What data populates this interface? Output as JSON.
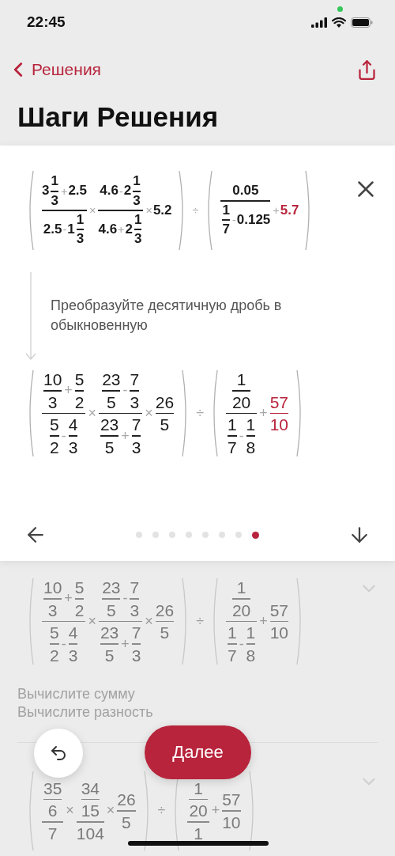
{
  "status_bar": {
    "time": "22:45"
  },
  "nav": {
    "back": "Решения"
  },
  "title": "Шаги Решения",
  "card": {
    "expression": [
      {
        "kind": "paren",
        "body": [
          {
            "kind": "frac",
            "top": [
              {
                "kind": "num",
                "v": "3"
              },
              {
                "kind": "frac",
                "top": [
                  {
                    "kind": "num",
                    "v": "1"
                  }
                ],
                "bottom": [
                  {
                    "kind": "num",
                    "v": "3"
                  }
                ]
              },
              {
                "kind": "op",
                "v": "+"
              },
              {
                "kind": "num",
                "v": "2.5"
              }
            ],
            "bottom": [
              {
                "kind": "num",
                "v": "2.5"
              },
              {
                "kind": "op",
                "v": "-"
              },
              {
                "kind": "num",
                "v": "1"
              },
              {
                "kind": "frac",
                "top": [
                  {
                    "kind": "num",
                    "v": "1"
                  }
                ],
                "bottom": [
                  {
                    "kind": "num",
                    "v": "3"
                  }
                ]
              }
            ]
          },
          {
            "kind": "op",
            "v": "×"
          },
          {
            "kind": "frac",
            "top": [
              {
                "kind": "num",
                "v": "4.6"
              },
              {
                "kind": "op",
                "v": "-"
              },
              {
                "kind": "num",
                "v": "2"
              },
              {
                "kind": "frac",
                "top": [
                  {
                    "kind": "num",
                    "v": "1"
                  }
                ],
                "bottom": [
                  {
                    "kind": "num",
                    "v": "3"
                  }
                ]
              }
            ],
            "bottom": [
              {
                "kind": "num",
                "v": "4.6"
              },
              {
                "kind": "op",
                "v": "+"
              },
              {
                "kind": "num",
                "v": "2"
              },
              {
                "kind": "frac",
                "top": [
                  {
                    "kind": "num",
                    "v": "1"
                  }
                ],
                "bottom": [
                  {
                    "kind": "num",
                    "v": "3"
                  }
                ]
              }
            ]
          },
          {
            "kind": "op",
            "v": "×"
          },
          {
            "kind": "num",
            "v": "5.2"
          }
        ]
      },
      {
        "kind": "op",
        "v": "÷"
      },
      {
        "kind": "paren",
        "body": [
          {
            "kind": "frac",
            "top": [
              {
                "kind": "num",
                "v": "0.05"
              }
            ],
            "bottom": [
              {
                "kind": "frac",
                "top": [
                  {
                    "kind": "num",
                    "v": "1"
                  }
                ],
                "bottom": [
                  {
                    "kind": "num",
                    "v": "7"
                  }
                ]
              },
              {
                "kind": "op",
                "v": "-"
              },
              {
                "kind": "num",
                "v": "0.125"
              }
            ]
          },
          {
            "kind": "op",
            "v": "+"
          },
          {
            "kind": "accent",
            "body": [
              {
                "kind": "num",
                "v": "5.7"
              }
            ]
          }
        ]
      }
    ],
    "instruction": "Преобразуйте десятичную дробь в обыкновенную",
    "result": [
      {
        "kind": "paren",
        "body": [
          {
            "kind": "frac",
            "top": [
              {
                "kind": "frac",
                "top": [
                  {
                    "kind": "num",
                    "v": "10"
                  }
                ],
                "bottom": [
                  {
                    "kind": "num",
                    "v": "3"
                  }
                ]
              },
              {
                "kind": "op",
                "v": "+"
              },
              {
                "kind": "frac",
                "top": [
                  {
                    "kind": "num",
                    "v": "5"
                  }
                ],
                "bottom": [
                  {
                    "kind": "num",
                    "v": "2"
                  }
                ]
              }
            ],
            "bottom": [
              {
                "kind": "frac",
                "top": [
                  {
                    "kind": "num",
                    "v": "5"
                  }
                ],
                "bottom": [
                  {
                    "kind": "num",
                    "v": "2"
                  }
                ]
              },
              {
                "kind": "op",
                "v": "-"
              },
              {
                "kind": "frac",
                "top": [
                  {
                    "kind": "num",
                    "v": "4"
                  }
                ],
                "bottom": [
                  {
                    "kind": "num",
                    "v": "3"
                  }
                ]
              }
            ]
          },
          {
            "kind": "op",
            "v": "×"
          },
          {
            "kind": "frac",
            "top": [
              {
                "kind": "frac",
                "top": [
                  {
                    "kind": "num",
                    "v": "23"
                  }
                ],
                "bottom": [
                  {
                    "kind": "num",
                    "v": "5"
                  }
                ]
              },
              {
                "kind": "op",
                "v": "-"
              },
              {
                "kind": "frac",
                "top": [
                  {
                    "kind": "num",
                    "v": "7"
                  }
                ],
                "bottom": [
                  {
                    "kind": "num",
                    "v": "3"
                  }
                ]
              }
            ],
            "bottom": [
              {
                "kind": "frac",
                "top": [
                  {
                    "kind": "num",
                    "v": "23"
                  }
                ],
                "bottom": [
                  {
                    "kind": "num",
                    "v": "5"
                  }
                ]
              },
              {
                "kind": "op",
                "v": "+"
              },
              {
                "kind": "frac",
                "top": [
                  {
                    "kind": "num",
                    "v": "7"
                  }
                ],
                "bottom": [
                  {
                    "kind": "num",
                    "v": "3"
                  }
                ]
              }
            ]
          },
          {
            "kind": "op",
            "v": "×"
          },
          {
            "kind": "frac",
            "top": [
              {
                "kind": "num",
                "v": "26"
              }
            ],
            "bottom": [
              {
                "kind": "num",
                "v": "5"
              }
            ]
          }
        ]
      },
      {
        "kind": "op",
        "v": "÷"
      },
      {
        "kind": "paren",
        "body": [
          {
            "kind": "frac",
            "top": [
              {
                "kind": "frac",
                "top": [
                  {
                    "kind": "num",
                    "v": "1"
                  }
                ],
                "bottom": [
                  {
                    "kind": "num",
                    "v": "20"
                  }
                ]
              }
            ],
            "bottom": [
              {
                "kind": "frac",
                "top": [
                  {
                    "kind": "num",
                    "v": "1"
                  }
                ],
                "bottom": [
                  {
                    "kind": "num",
                    "v": "7"
                  }
                ]
              },
              {
                "kind": "op",
                "v": "-"
              },
              {
                "kind": "frac",
                "top": [
                  {
                    "kind": "num",
                    "v": "1"
                  }
                ],
                "bottom": [
                  {
                    "kind": "num",
                    "v": "8"
                  }
                ]
              }
            ]
          },
          {
            "kind": "op",
            "v": "+"
          },
          {
            "kind": "accent",
            "body": [
              {
                "kind": "frac",
                "top": [
                  {
                    "kind": "num",
                    "v": "57"
                  }
                ],
                "bottom": [
                  {
                    "kind": "num",
                    "v": "10"
                  }
                ]
              }
            ]
          }
        ]
      }
    ],
    "pager": [
      {
        "selected": false
      },
      {
        "selected": false
      },
      {
        "selected": false
      },
      {
        "selected": false
      },
      {
        "selected": false
      },
      {
        "selected": false
      },
      {
        "selected": false
      },
      {
        "selected": true
      }
    ]
  },
  "steps": [
    {
      "expression": [
        {
          "kind": "paren",
          "body": [
            {
              "kind": "frac",
              "top": [
                {
                  "kind": "frac",
                  "top": [
                    {
                      "kind": "num",
                      "v": "10"
                    }
                  ],
                  "bottom": [
                    {
                      "kind": "num",
                      "v": "3"
                    }
                  ]
                },
                {
                  "kind": "op",
                  "v": "+"
                },
                {
                  "kind": "frac",
                  "top": [
                    {
                      "kind": "num",
                      "v": "5"
                    }
                  ],
                  "bottom": [
                    {
                      "kind": "num",
                      "v": "2"
                    }
                  ]
                }
              ],
              "bottom": [
                {
                  "kind": "frac",
                  "top": [
                    {
                      "kind": "num",
                      "v": "5"
                    }
                  ],
                  "bottom": [
                    {
                      "kind": "num",
                      "v": "2"
                    }
                  ]
                },
                {
                  "kind": "op",
                  "v": "-"
                },
                {
                  "kind": "frac",
                  "top": [
                    {
                      "kind": "num",
                      "v": "4"
                    }
                  ],
                  "bottom": [
                    {
                      "kind": "num",
                      "v": "3"
                    }
                  ]
                }
              ]
            },
            {
              "kind": "op",
              "v": "×"
            },
            {
              "kind": "frac",
              "top": [
                {
                  "kind": "frac",
                  "top": [
                    {
                      "kind": "num",
                      "v": "23"
                    }
                  ],
                  "bottom": [
                    {
                      "kind": "num",
                      "v": "5"
                    }
                  ]
                },
                {
                  "kind": "op",
                  "v": "-"
                },
                {
                  "kind": "frac",
                  "top": [
                    {
                      "kind": "num",
                      "v": "7"
                    }
                  ],
                  "bottom": [
                    {
                      "kind": "num",
                      "v": "3"
                    }
                  ]
                }
              ],
              "bottom": [
                {
                  "kind": "frac",
                  "top": [
                    {
                      "kind": "num",
                      "v": "23"
                    }
                  ],
                  "bottom": [
                    {
                      "kind": "num",
                      "v": "5"
                    }
                  ]
                },
                {
                  "kind": "op",
                  "v": "+"
                },
                {
                  "kind": "frac",
                  "top": [
                    {
                      "kind": "num",
                      "v": "7"
                    }
                  ],
                  "bottom": [
                    {
                      "kind": "num",
                      "v": "3"
                    }
                  ]
                }
              ]
            },
            {
              "kind": "op",
              "v": "×"
            },
            {
              "kind": "frac",
              "top": [
                {
                  "kind": "num",
                  "v": "26"
                }
              ],
              "bottom": [
                {
                  "kind": "num",
                  "v": "5"
                }
              ]
            }
          ]
        },
        {
          "kind": "op",
          "v": "÷"
        },
        {
          "kind": "paren",
          "body": [
            {
              "kind": "frac",
              "top": [
                {
                  "kind": "frac",
                  "top": [
                    {
                      "kind": "num",
                      "v": "1"
                    }
                  ],
                  "bottom": [
                    {
                      "kind": "num",
                      "v": "20"
                    }
                  ]
                }
              ],
              "bottom": [
                {
                  "kind": "frac",
                  "top": [
                    {
                      "kind": "num",
                      "v": "1"
                    }
                  ],
                  "bottom": [
                    {
                      "kind": "num",
                      "v": "7"
                    }
                  ]
                },
                {
                  "kind": "op",
                  "v": "-"
                },
                {
                  "kind": "frac",
                  "top": [
                    {
                      "kind": "num",
                      "v": "1"
                    }
                  ],
                  "bottom": [
                    {
                      "kind": "num",
                      "v": "8"
                    }
                  ]
                }
              ]
            },
            {
              "kind": "op",
              "v": "+"
            },
            {
              "kind": "frac",
              "top": [
                {
                  "kind": "num",
                  "v": "57"
                }
              ],
              "bottom": [
                {
                  "kind": "num",
                  "v": "10"
                }
              ]
            }
          ]
        }
      ],
      "notes": [
        "Вычислите сумму",
        "Вычислите разность"
      ]
    },
    {
      "expression": [
        {
          "kind": "paren",
          "body": [
            {
              "kind": "frac",
              "top": [
                {
                  "kind": "frac",
                  "top": [
                    {
                      "kind": "num",
                      "v": "35"
                    }
                  ],
                  "bottom": [
                    {
                      "kind": "num",
                      "v": "6"
                    }
                  ]
                }
              ],
              "bottom": [
                {
                  "kind": "num",
                  "v": "7"
                }
              ]
            },
            {
              "kind": "op",
              "v": "×"
            },
            {
              "kind": "frac",
              "top": [
                {
                  "kind": "frac",
                  "top": [
                    {
                      "kind": "num",
                      "v": "34"
                    }
                  ],
                  "bottom": [
                    {
                      "kind": "num",
                      "v": "15"
                    }
                  ]
                }
              ],
              "bottom": [
                {
                  "kind": "num",
                  "v": "104"
                }
              ]
            },
            {
              "kind": "op",
              "v": "×"
            },
            {
              "kind": "frac",
              "top": [
                {
                  "kind": "num",
                  "v": "26"
                }
              ],
              "bottom": [
                {
                  "kind": "num",
                  "v": "5"
                }
              ]
            }
          ]
        },
        {
          "kind": "op",
          "v": "÷"
        },
        {
          "kind": "paren",
          "body": [
            {
              "kind": "frac",
              "top": [
                {
                  "kind": "frac",
                  "top": [
                    {
                      "kind": "num",
                      "v": "1"
                    }
                  ],
                  "bottom": [
                    {
                      "kind": "num",
                      "v": "20"
                    }
                  ]
                }
              ],
              "bottom": [
                {
                  "kind": "num",
                  "v": "1"
                }
              ]
            },
            {
              "kind": "op",
              "v": "+"
            },
            {
              "kind": "frac",
              "top": [
                {
                  "kind": "num",
                  "v": "57"
                }
              ],
              "bottom": [
                {
                  "kind": "num",
                  "v": "10"
                }
              ]
            }
          ]
        }
      ]
    }
  ],
  "next_button": "Далее"
}
